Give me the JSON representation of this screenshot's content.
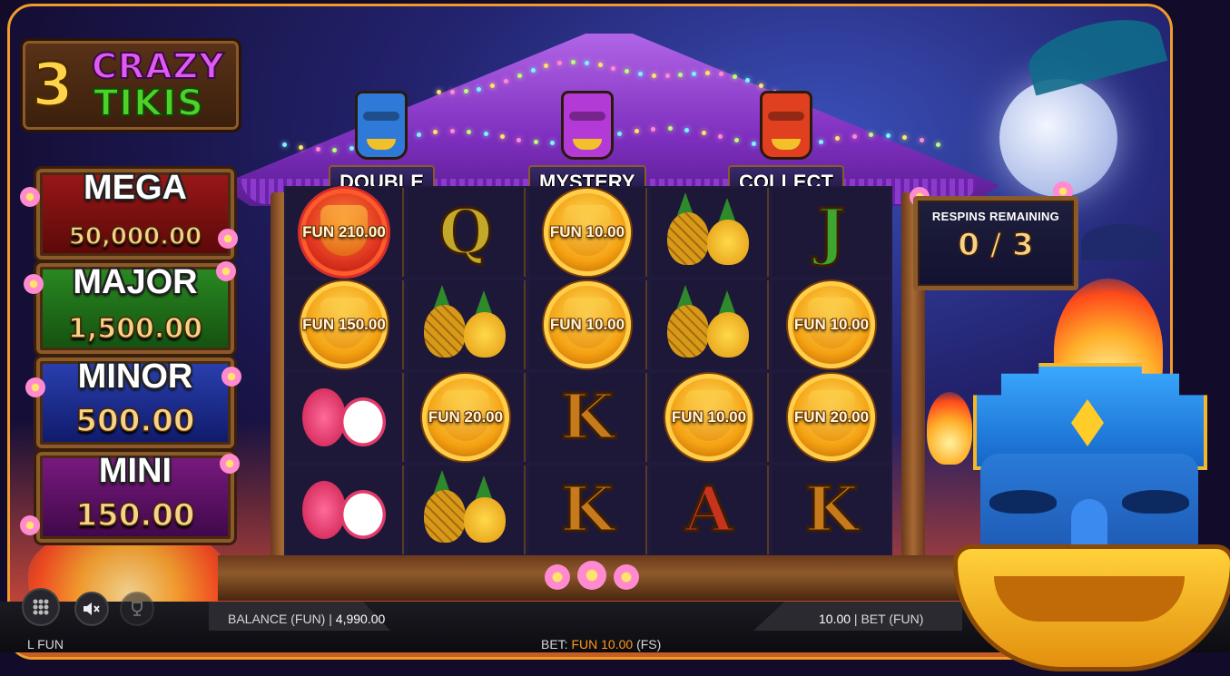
{
  "game": {
    "logo_number": "3",
    "logo_word1": "CRAZY",
    "logo_word2": "TIKIS"
  },
  "features": [
    {
      "label": "DOUBLE",
      "color": "#2f7ad8"
    },
    {
      "label": "MYSTERY",
      "color": "#b43ad8"
    },
    {
      "label": "COLLECT",
      "color": "#e0401f"
    }
  ],
  "jackpots": [
    {
      "name": "MEGA",
      "value": "50,000.00",
      "color": "#7a1010"
    },
    {
      "name": "MAJOR",
      "value": "1,500.00",
      "color": "#1d6a1a"
    },
    {
      "name": "MINOR",
      "value": "500.00",
      "color": "#1a2f8a"
    },
    {
      "name": "MINI",
      "value": "150.00",
      "color": "#5a1060"
    }
  ],
  "respins": {
    "title": "RESPINS REMAINING",
    "count": "0 / 3"
  },
  "grid": [
    [
      {
        "type": "coin",
        "variant": "red",
        "label": "FUN 210.00"
      },
      {
        "type": "letter",
        "value": "Q"
      },
      {
        "type": "coin",
        "label": "FUN 10.00"
      },
      {
        "type": "fruit",
        "value": "pineapple"
      },
      {
        "type": "letter",
        "value": "J"
      }
    ],
    [
      {
        "type": "coin",
        "label": "FUN 150.00"
      },
      {
        "type": "fruit",
        "value": "pineapple"
      },
      {
        "type": "coin",
        "label": "FUN 10.00"
      },
      {
        "type": "fruit",
        "value": "pineapple"
      },
      {
        "type": "coin",
        "label": "FUN 10.00"
      }
    ],
    [
      {
        "type": "fruit",
        "value": "dragonfruit"
      },
      {
        "type": "coin",
        "label": "FUN 20.00"
      },
      {
        "type": "letter",
        "value": "K"
      },
      {
        "type": "coin",
        "label": "FUN 10.00"
      },
      {
        "type": "coin",
        "label": "FUN 20.00"
      }
    ],
    [
      {
        "type": "fruit",
        "value": "dragonfruit"
      },
      {
        "type": "fruit",
        "value": "pineapple"
      },
      {
        "type": "letter",
        "value": "K"
      },
      {
        "type": "letter",
        "value": "A"
      },
      {
        "type": "letter",
        "value": "K"
      }
    ]
  ],
  "bottom_bar": {
    "balance_label": "BALANCE (FUN)",
    "balance_value": "4,990.00",
    "bet_amount": "10.00",
    "bet_label": "BET (FUN)",
    "win_text": "L FUN",
    "bet_prefix": "BET:",
    "bet_fun": "FUN 10.00",
    "bet_suffix": "(FS)"
  },
  "controls": {
    "menu_icon": "grid-menu-icon",
    "sound_icon": "mute-icon",
    "trophy_icon": "trophy-icon"
  }
}
